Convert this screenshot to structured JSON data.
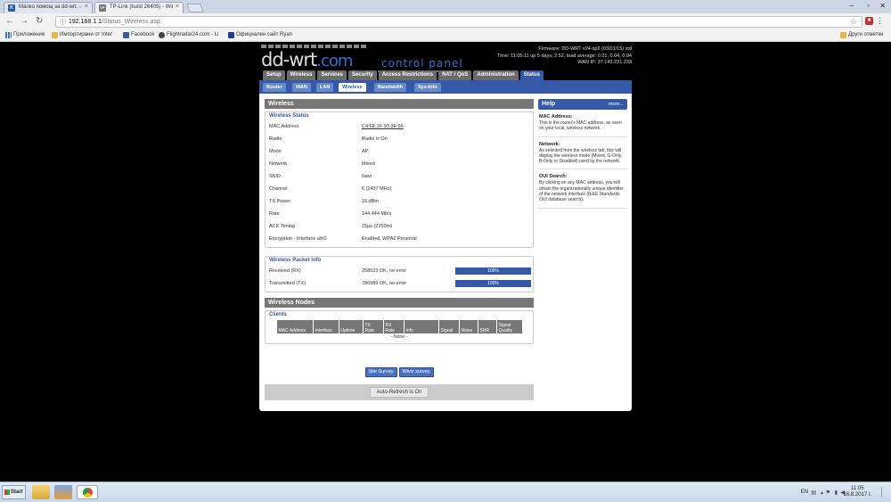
{
  "browser": {
    "tabs": [
      {
        "title": "Малко помощ за dd-wrt. - ",
        "favicon_label": "K"
      },
      {
        "title": "TP-Link (build 26405) - Wir",
        "favicon_label": "TP"
      }
    ],
    "url_host": "192.168.1.1",
    "url_path": "/Status_Wireless.asp",
    "bookmarks": [
      "Приложения",
      "Импортирани от Inter",
      "Facebook",
      "Flightradar24.com - Li",
      "Официален сайт Ryan"
    ],
    "other_bookmarks": "Други отметки"
  },
  "router": {
    "logo_main": "dd-wrt",
    "logo_suffix": ".com",
    "control_panel": "control panel",
    "firmware": "Firmware: DD-WRT v24-sp2 (03/01/15) std",
    "time": "Time: 11:05:11 up 5 days, 2:52, load average: 0.01, 0.04, 0.04",
    "wan_ip": "WAN IP: 37.143.231.233"
  },
  "main_tabs": [
    "Setup",
    "Wireless",
    "Services",
    "Security",
    "Access Restrictions",
    "NAT / QoS",
    "Administration",
    "Status"
  ],
  "sub_tabs": [
    "Router",
    "WAN",
    "LAN",
    "Wireless",
    "Bandwidth",
    "Sys-Info"
  ],
  "wireless": {
    "heading": "Wireless",
    "status_legend": "Wireless Status",
    "rows": [
      {
        "label": "MAC Address",
        "value": "C4:6E:1F:93:3E:66"
      },
      {
        "label": "Radio",
        "value": "Radio is On"
      },
      {
        "label": "Mode",
        "value": "AP"
      },
      {
        "label": "Network",
        "value": "Mixed"
      },
      {
        "label": "SSID",
        "value": "Ilawi"
      },
      {
        "label": "Channel",
        "value": "6 (2437 MHz)"
      },
      {
        "label": "TX Power",
        "value": "16 dBm"
      },
      {
        "label": "Rate",
        "value": "144.444 Mb/s"
      },
      {
        "label": "ACK Timing",
        "value": "15µs (2250m)"
      },
      {
        "label": "Encryption - Interface ath0",
        "value": "Enabled, WPA2 Personal"
      }
    ],
    "packet_legend": "Wireless Packet Info",
    "packets": [
      {
        "label": "Received (RX)",
        "value": "258523 OK, no error",
        "percent": "100%"
      },
      {
        "label": "Transmitted (TX)",
        "value": "786989 OK, no error",
        "percent": "100%"
      }
    ],
    "nodes_heading": "Wireless Nodes",
    "clients_legend": "Clients",
    "client_columns": [
      "MAC Address",
      "Interface",
      "Uptime",
      "TX Rate",
      "RX Rate",
      "Info",
      "Signal",
      "Noise",
      "SNR",
      "Signal Quality"
    ],
    "none_text": "- None -",
    "site_survey": "Site Survey",
    "wiviz_survey": "Wiviz survey",
    "auto_refresh": "Auto-Refresh is On"
  },
  "help": {
    "title": "Help",
    "more": "more...",
    "sections": [
      {
        "title": "MAC Address:",
        "body": "This is the router's MAC address, as seen on your local, wireless network."
      },
      {
        "title": "Network:",
        "body": "As selected from the wireless tab, this will display the wireless mode (Mixed, G-Only, B-Only or Disabled) used by the network."
      },
      {
        "title": "OUI Search:",
        "body": "By clicking on any MAC address, you will obtain the organizationally unique identifier of the network interface (IEEE Standards OUI database search)."
      }
    ]
  },
  "taskbar": {
    "start": "Start",
    "lang": "EN",
    "time": "11:05",
    "date": "16.8.2017 г."
  }
}
